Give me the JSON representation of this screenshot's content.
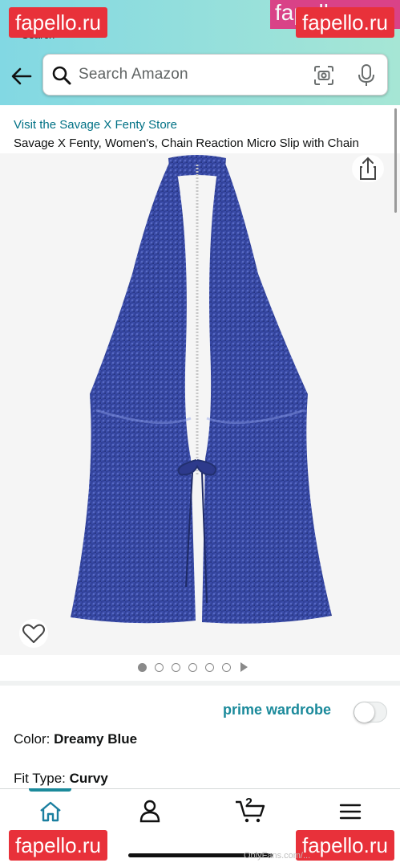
{
  "header": {
    "status_fragment": "Search",
    "search_placeholder": "Search Amazon"
  },
  "watermarks": {
    "top_left": "fapello.ru",
    "top_right": "fapello.ru",
    "top_right_back": "fapello.ru",
    "bottom_left": "fapello.ru",
    "bottom_right": "fapello.ru",
    "bottom_overlay": "OnlyFans.com/..."
  },
  "product": {
    "store_link": "Visit the Savage X Fenty Store",
    "title": "Savage X Fenty, Women's, Chain Reaction Micro Slip with Chain",
    "image_count": 6,
    "active_image_index": 0,
    "image_description_icon": "sequin-halter-top"
  },
  "prime_wardrobe": {
    "label": "prime wardrobe",
    "toggle_on": false
  },
  "options": {
    "color_label": "Color:",
    "color_value": "Dreamy Blue",
    "fit_label": "Fit Type:",
    "fit_value": "Curvy"
  },
  "bottom_nav": {
    "items": [
      "home-icon",
      "user-icon",
      "cart-icon",
      "menu-icon"
    ],
    "active": "home-icon",
    "cart_count": "2"
  },
  "colors": {
    "header_gradient_start": "#82d8e3",
    "header_gradient_end": "#a6e6d5",
    "link": "#007185",
    "prime": "#1b8a9b",
    "product": "#2d3a8c"
  }
}
